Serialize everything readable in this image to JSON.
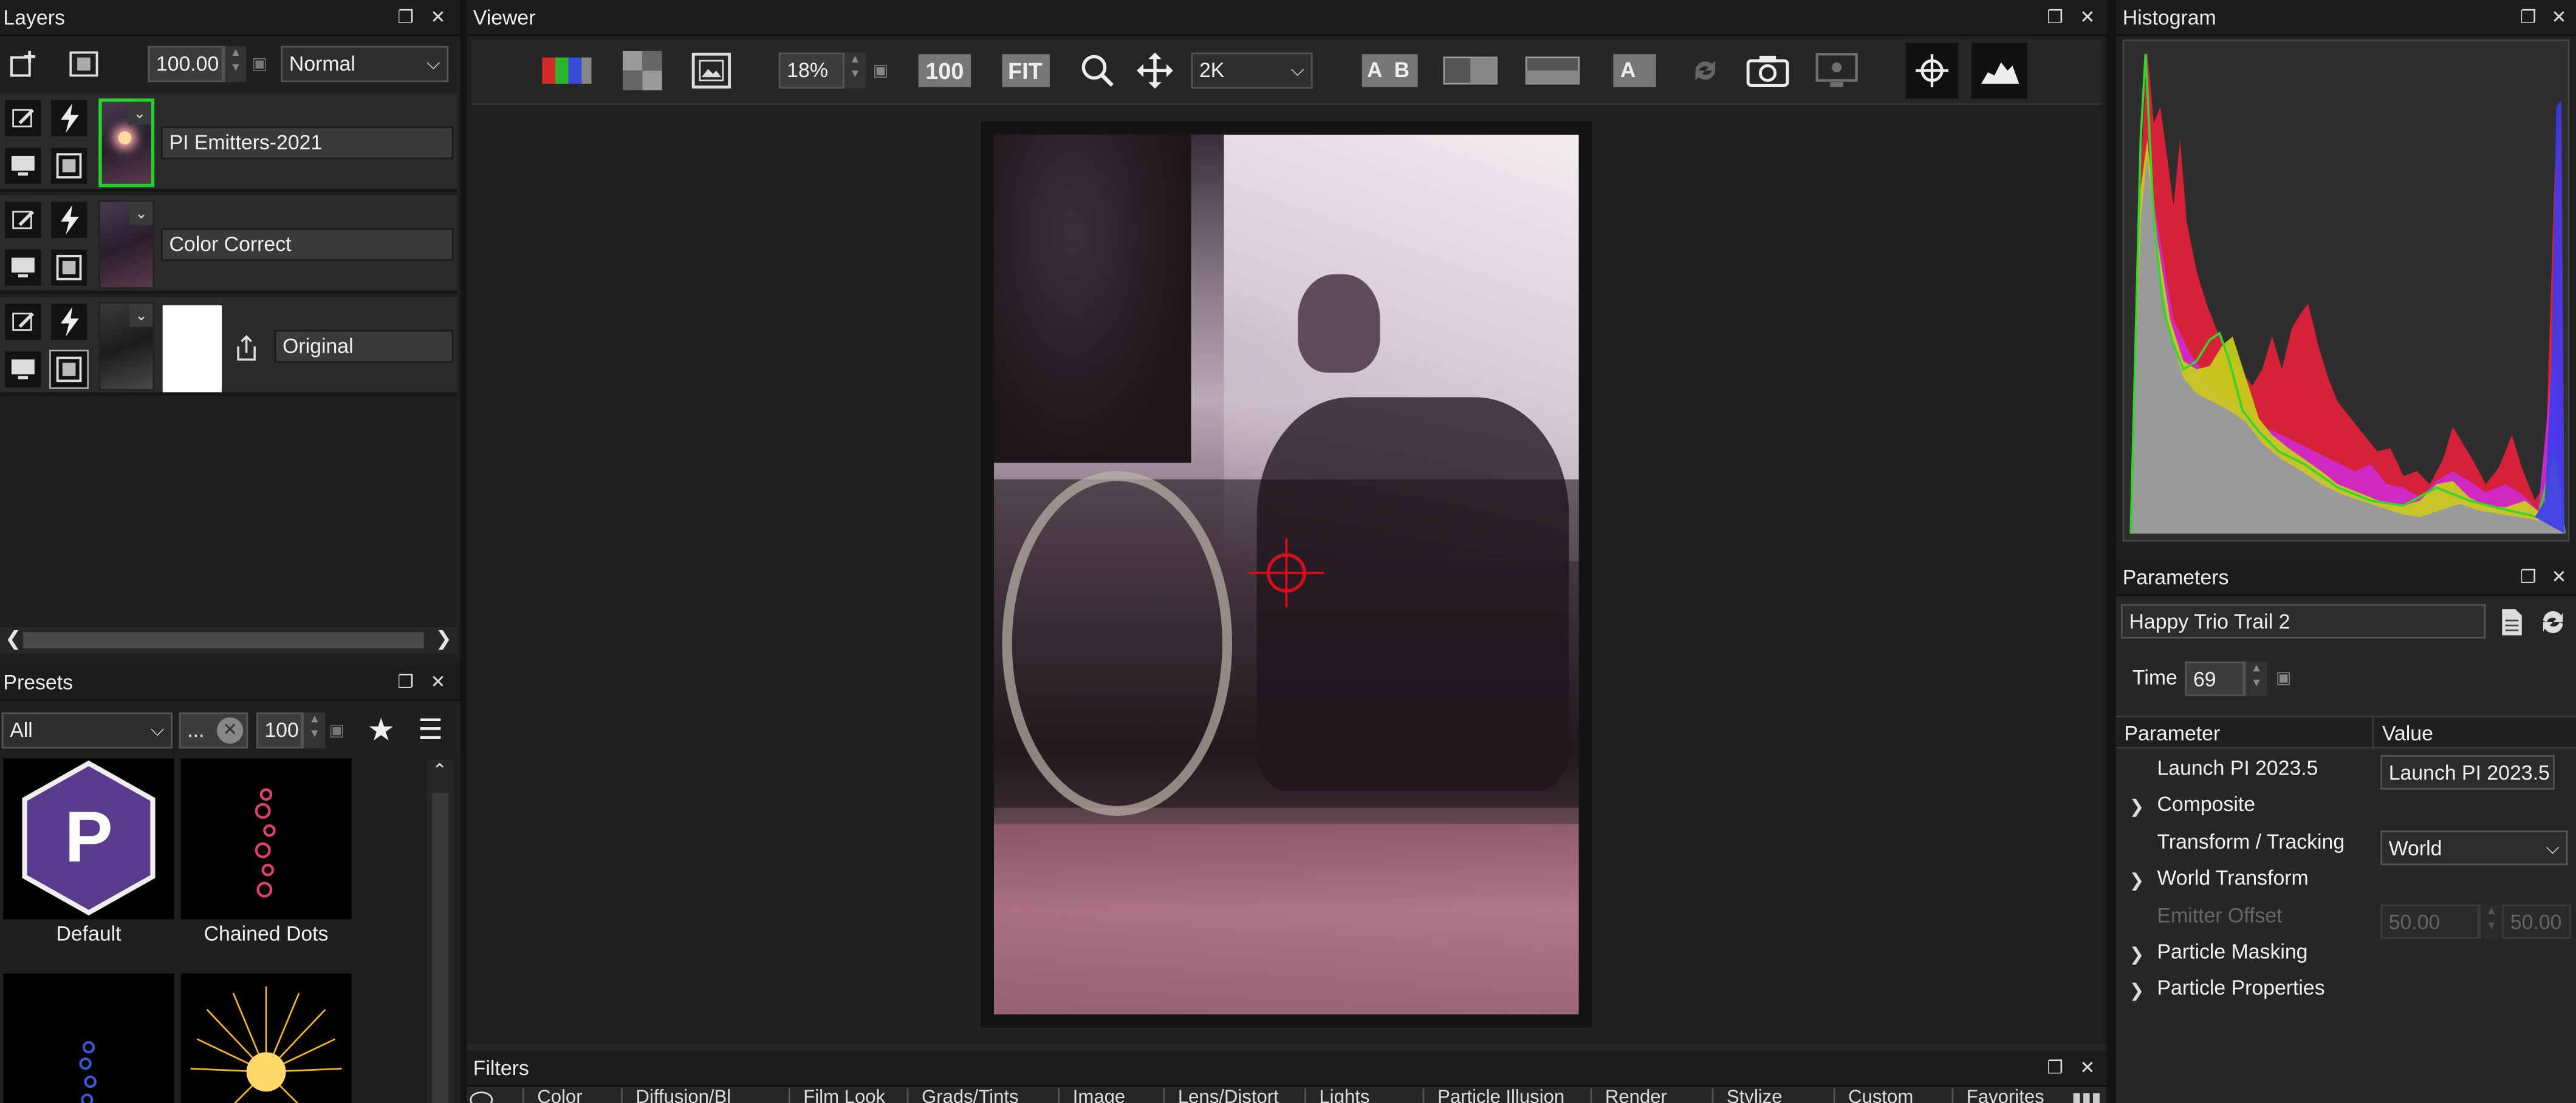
{
  "layers_panel": {
    "title": "Layers",
    "opacity": "100.00",
    "blend_mode": "Normal",
    "layers": [
      {
        "name": "PI Emitters-2021",
        "selected": true
      },
      {
        "name": "Color Correct",
        "selected": false
      },
      {
        "name": "Original",
        "selected": false
      }
    ]
  },
  "presets_panel": {
    "title": "Presets",
    "category": "All",
    "search": "...",
    "size": "100",
    "items": [
      {
        "label": "Default",
        "icon": "boris-p-logo-icon"
      },
      {
        "label": "Chained Dots",
        "icon": "chained-dots-thumb"
      },
      {
        "label": "",
        "icon": "blue-spiral-thumb"
      },
      {
        "label": "",
        "icon": "gold-burst-thumb"
      }
    ]
  },
  "viewer_panel": {
    "title": "Viewer",
    "zoom": "18%",
    "btn_100": "100",
    "btn_fit": "FIT",
    "resolution": "2K",
    "ab_label": "A B",
    "a_label": "A"
  },
  "histogram_panel": {
    "title": "Histogram",
    "colors": {
      "red": "#e8213a",
      "green": "#37d42f",
      "blue": "#3b3bf0",
      "yellow": "#c8d41a",
      "magenta": "#cf2ad0",
      "grey": "#9a9a9a"
    }
  },
  "parameters_panel": {
    "title": "Parameters",
    "preset_name": "Happy Trio Trail 2",
    "time_label": "Time",
    "time_value": "69",
    "col_parameter": "Parameter",
    "col_value": "Value",
    "rows": [
      {
        "label": "Launch PI 2023.5",
        "value": "Launch PI 2023.5",
        "expand": false
      },
      {
        "label": "Composite",
        "expand": true
      },
      {
        "label": "Transform / Tracking",
        "value": "World",
        "expand": false
      },
      {
        "label": "World Transform",
        "expand": true
      },
      {
        "label": "Emitter Offset",
        "value_a": "50.00",
        "value_b": "50.00",
        "expand": false,
        "disabled": true
      },
      {
        "label": "Particle Masking",
        "expand": true
      },
      {
        "label": "Particle Properties",
        "expand": true
      }
    ]
  },
  "filters_panel": {
    "title": "Filters",
    "tabs": [
      "Color",
      "Diffusion/Bl",
      "Film Look",
      "Grads/Tints",
      "Image",
      "Lens/Distort",
      "Lights",
      "Particle Illusion",
      "Render",
      "Stylize",
      "Custom",
      "Favorites"
    ]
  }
}
